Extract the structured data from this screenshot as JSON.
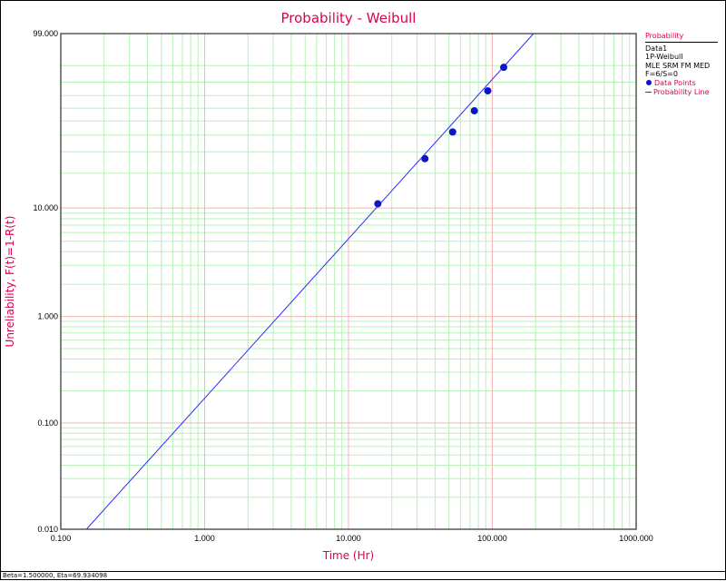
{
  "chart_data": {
    "type": "scatter",
    "title": "Probability - Weibull",
    "xlabel": "Time (Hr)",
    "ylabel": "Unreliability, F(t)=1-R(t)",
    "x_scale": "log",
    "y_scale": "weibull",
    "xlim": [
      0.1,
      1000
    ],
    "ylim": [
      0.01,
      99
    ],
    "x_ticks": [
      "0.100",
      "1.000",
      "10.000",
      "100.000",
      "1000.000"
    ],
    "y_ticks": [
      "0.010",
      "0.100",
      "1.000",
      "10.000",
      "99.000"
    ],
    "grid": true,
    "legend_position": "right",
    "series": [
      {
        "name": "Data Points",
        "kind": "points",
        "color": "#0b16c9",
        "x": [
          16.0,
          34.0,
          53.0,
          75.0,
          93.0,
          120.0
        ],
        "y": [
          10.9,
          26.4,
          42.1,
          57.9,
          73.6,
          89.1
        ]
      },
      {
        "name": "Probability Line",
        "kind": "line",
        "color": "#2d2dff",
        "beta": 1.5,
        "eta": 69.934098
      }
    ]
  },
  "legend": {
    "title": "Probability",
    "lines": [
      "Data1",
      "1P-Weibull",
      "MLE SRM FM MED",
      "F=6/S=0"
    ],
    "points_label": "Data Points",
    "line_label": "Probability Line"
  },
  "status_text": "Beta=1.500000, Eta=69.934098",
  "colors": {
    "title": "#e0004d",
    "major_grid": "#f7b5b5",
    "minor_grid": "#b8f0b8",
    "points": "#0b16c9",
    "line": "#2d2dff"
  }
}
